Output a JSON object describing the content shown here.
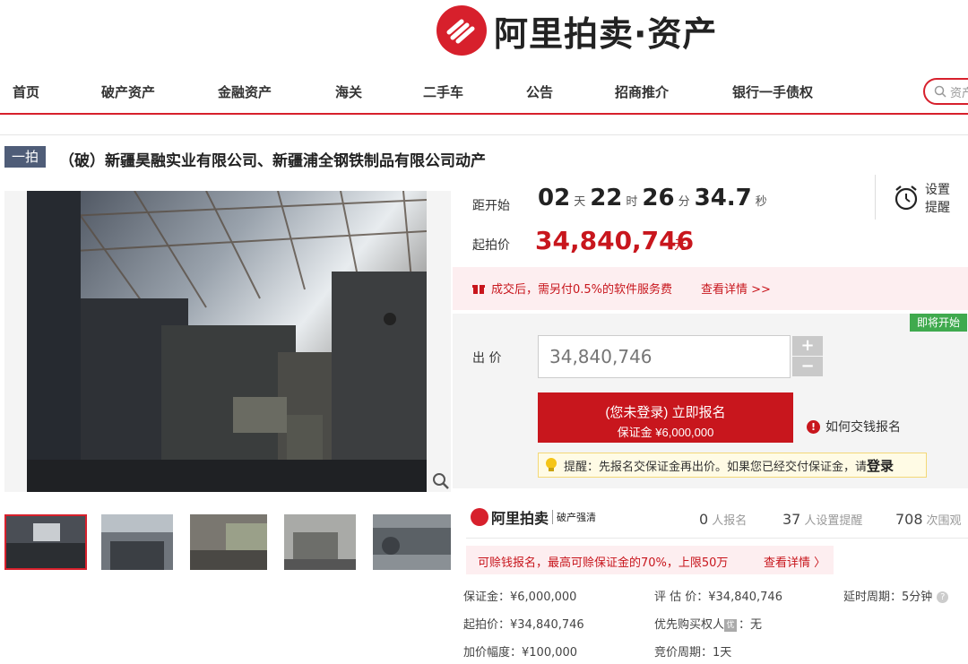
{
  "header": {
    "logo_text": "阿里拍卖·资产",
    "brand_color": "#d7202c"
  },
  "nav": {
    "items": [
      "首页",
      "破产资产",
      "金融资产",
      "海关",
      "二手车",
      "公告",
      "招商推介",
      "银行一手债权"
    ],
    "search_placeholder": "资产"
  },
  "listing": {
    "badge": "一拍",
    "title": "（破）新疆昊融实业有限公司、新疆浦全钢铁制品有限公司动产"
  },
  "countdown": {
    "label": "距开始",
    "days": "02",
    "days_unit": "天",
    "hours": "22",
    "hours_unit": "时",
    "minutes": "26",
    "minutes_unit": "分",
    "seconds": "34.7",
    "seconds_unit": "秒"
  },
  "reminder": {
    "label_line1": "设置",
    "label_line2": "提醒"
  },
  "price": {
    "label": "起拍价",
    "value": "34,840,746",
    "unit": "元"
  },
  "fee_notice": {
    "text": "成交后，需另付0.5%的软件服务费",
    "link": "查看详情 >>"
  },
  "bid": {
    "status_tag": "即将开始",
    "label": "出 价",
    "input_placeholder": "34,840,746",
    "plus": "+",
    "minus": "−",
    "signup_main": "(您未登录) 立即报名",
    "signup_sub": "保证金 ¥6,000,000",
    "howto": "如何交钱报名",
    "tip_text": "提醒：先报名交保证金再出价。如果您已经交付保证金，请",
    "tip_login": "登录"
  },
  "brand_block": {
    "name": "阿里拍卖",
    "sub": "破产强清"
  },
  "stats": {
    "signups_num": "0",
    "signups_label": "人报名",
    "reminders_num": "37",
    "reminders_label": "人设置提醒",
    "views_num": "708",
    "views_label": "次围观"
  },
  "compensate": {
    "text": "可赊钱报名，最高可赊保证金的70%，上限50万",
    "link": "查看详情 〉"
  },
  "details": {
    "deposit": "保证金：¥6,000,000",
    "appraisal": "评 估 价：¥34,840,746",
    "extension": "延时周期：5分钟",
    "start_price": "起拍价：¥34,840,746",
    "priority_label": "优先购买权人",
    "priority_icon": "优",
    "priority_value": "：无",
    "increment": "加价幅度：¥100,000",
    "bid_period": "竞价周期：1天"
  }
}
